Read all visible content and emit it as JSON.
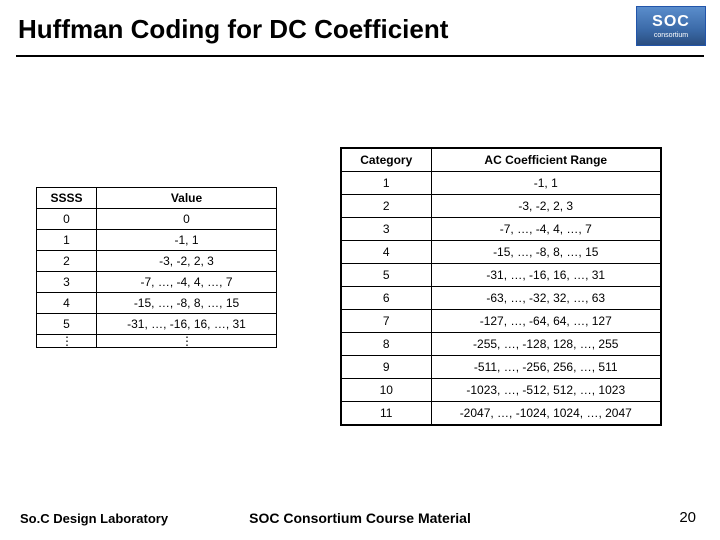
{
  "title": "Huffman Coding for DC Coefficient",
  "logo": {
    "big": "SOC",
    "small": "consortium"
  },
  "left_table": {
    "headers": [
      "SSSS",
      "Value"
    ],
    "rows": [
      {
        "ssss": "0",
        "value": "0"
      },
      {
        "ssss": "1",
        "value": "-1, 1"
      },
      {
        "ssss": "2",
        "value": "-3, -2, 2, 3"
      },
      {
        "ssss": "3",
        "value": "-7, …, -4, 4, …, 7"
      },
      {
        "ssss": "4",
        "value": "-15, …, -8, 8, …, 15"
      },
      {
        "ssss": "5",
        "value": "-31, …, -16, 16, …, 31"
      }
    ],
    "ellipsis": "⋮"
  },
  "right_table": {
    "headers": [
      "Category",
      "AC Coefficient Range"
    ],
    "rows": [
      {
        "cat": "1",
        "range": "-1, 1"
      },
      {
        "cat": "2",
        "range": "-3, -2, 2, 3"
      },
      {
        "cat": "3",
        "range": "-7, …, -4, 4, …, 7"
      },
      {
        "cat": "4",
        "range": "-15, …, -8, 8, …, 15"
      },
      {
        "cat": "5",
        "range": "-31, …, -16, 16, …, 31"
      },
      {
        "cat": "6",
        "range": "-63, …, -32, 32, …, 63"
      },
      {
        "cat": "7",
        "range": "-127, …, -64, 64, …, 127"
      },
      {
        "cat": "8",
        "range": "-255, …, -128, 128, …, 255"
      },
      {
        "cat": "9",
        "range": "-511, …, -256, 256, …, 511"
      },
      {
        "cat": "10",
        "range": "-1023, …, -512, 512, …, 1023"
      },
      {
        "cat": "11",
        "range": "-2047, …, -1024, 1024, …, 2047"
      }
    ]
  },
  "footer": {
    "left": "So.C Design Laboratory",
    "center": "SOC Consortium Course Material",
    "page": "20"
  }
}
